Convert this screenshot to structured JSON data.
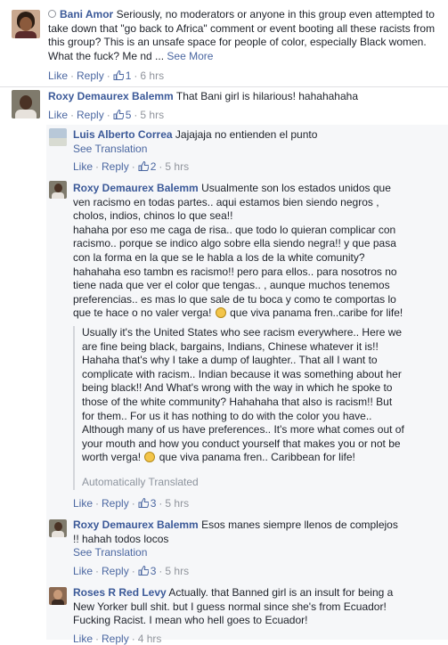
{
  "comments": [
    {
      "author": "Bani Amor",
      "text": "Seriously, no moderators or anyone in this group even attempted to take down that \"go back to Africa\" comment or event booting all these racists from this group? This is an unsafe space for people of color, especially Black women. What the fuck? Me nd ...",
      "see_more": "See More",
      "actions": {
        "like": "Like",
        "reply": "Reply",
        "likes": "1",
        "time": "6 hrs"
      }
    },
    {
      "author": "Roxy Demaurex Balemm",
      "text": "That Bani girl is hilarious! hahahahaha",
      "actions": {
        "like": "Like",
        "reply": "Reply",
        "likes": "5",
        "time": "5 hrs"
      }
    }
  ],
  "replies": [
    {
      "author": "Luis Alberto Correa",
      "text": "Jajajaja no entienden el punto",
      "see_translation": "See Translation",
      "actions": {
        "like": "Like",
        "reply": "Reply",
        "likes": "2",
        "time": "5 hrs"
      }
    },
    {
      "author": "Roxy Demaurex Balemm",
      "text_lines": [
        "Usualmente son los estados unidos que",
        "ven racismo en todas partes.. aqui estamos bien siendo negros ,",
        "cholos, indios, chinos lo que sea!!",
        "hahaha por eso me caga de risa.. que todo lo quieran complicar con",
        "racismo.. porque se indico algo sobre ella siendo negra!! y que pasa",
        "con la forma en la que se le habla a los de la white comunity?",
        "hahahaha eso tambn es racismo!! pero para ellos.. para nosotros no",
        "tiene nada que ver el color que tengas.. , aunque muchos tenemos",
        "preferencias.. es mas lo que sale de tu boca y como te comportas lo",
        "que te hace o no valer verga!",
        "que viva panama fren..caribe for life!"
      ],
      "translation_lines": [
        "Usually it's the United States who see racism everywhere.. Here we",
        "are fine being black, bargains, Indians, Chinese whatever it is!!",
        "Hahaha that's why I take a dump of laughter.. That all I want to",
        "complicate with racism.. Indian because it was something about her",
        "being black!! And What's wrong with the way in which he spoke to",
        "those of the white community? Hahahaha that also is racism!! But",
        "for them.. For us it has nothing to do with the color you have..",
        "Although many of us have preferences.. It's more what comes out of",
        "your mouth and how you conduct yourself that makes you or not be",
        "worth verga!",
        "que viva panama fren.. Caribbean for life!"
      ],
      "auto_translated": "Automatically Translated",
      "actions": {
        "like": "Like",
        "reply": "Reply",
        "likes": "3",
        "time": "5 hrs"
      }
    },
    {
      "author": "Roxy Demaurex Balemm",
      "text_lines": [
        "Esos manes siempre llenos de complejos",
        "!! hahah todos locos"
      ],
      "see_translation": "See Translation",
      "actions": {
        "like": "Like",
        "reply": "Reply",
        "likes": "3",
        "time": "5 hrs"
      }
    },
    {
      "author": "Roses R Red Levy",
      "text_lines": [
        "Actually. that Banned girl is an insult for being a",
        "New Yorker bull shit. but I guess normal since she's from Ecuador!",
        "Fucking Racist. I mean who hell goes to Ecuador!"
      ],
      "actions": {
        "like": "Like",
        "reply": "Reply",
        "likes": "",
        "time": "4 hrs"
      }
    }
  ],
  "colors": {
    "name": "#3b5998",
    "link": "#4b67a1",
    "meta": "#90949c",
    "reply_bg": "#f6f7f9"
  }
}
